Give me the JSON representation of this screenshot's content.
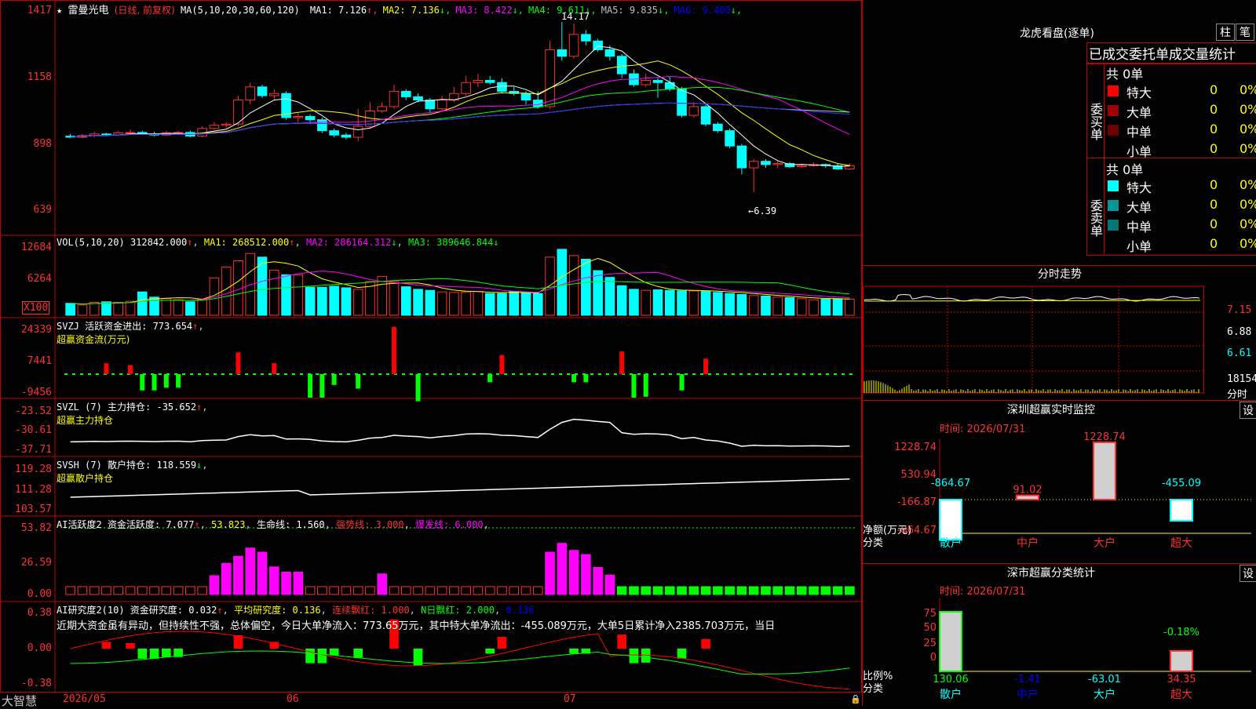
{
  "header": {
    "star": "★",
    "stock_name": "雷曼光电",
    "period": "(日线, 前复权)",
    "ma_label": "MA(5,10,20,30,60,120)",
    "ma": [
      {
        "label": "MA1: 7.126",
        "arrow": "↑",
        "color": "#ffffff"
      },
      {
        "label": "MA2: 7.136",
        "arrow": "↓",
        "color": "#ffff00"
      },
      {
        "label": "MA3: 8.422",
        "arrow": "↓",
        "color": "#ff00ff"
      },
      {
        "label": "MA4: 9.611",
        "arrow": "↓",
        "color": "#00ff00"
      },
      {
        "label": "MA5: 9.835",
        "arrow": "↓",
        "color": "#c0c0c0"
      },
      {
        "label": "MA6: 9.400",
        "arrow": "↓",
        "color": "#0000ff"
      }
    ]
  },
  "price_panel": {
    "y_labels": [
      "1417",
      "1158",
      "898",
      "639"
    ],
    "high_label": "14.17",
    "low_label": "←6.39"
  },
  "vol_panel": {
    "title": "VOL(5,10,20)",
    "value": "312842.000",
    "ma1": "MA1: 268512.000",
    "ma2": "MA2: 286164.312",
    "ma3": "MA3: 389646.844",
    "y_labels": [
      "12684",
      "6264"
    ],
    "unit": "X100"
  },
  "svzj_panel": {
    "title": "SVZJ  活跃资金进出: 773.654",
    "subtitle": "超赢资金流(万元)",
    "y_labels": [
      "24339",
      "7441",
      "-9456"
    ]
  },
  "svzl_panel": {
    "title": "SVZL (7) 主力持仓: -35.652",
    "subtitle": "超赢主力持仓",
    "y_labels": [
      "-23.52",
      "-30.61",
      "-37.71"
    ]
  },
  "svsh_panel": {
    "title": "SVSH (7) 散户持仓: 118.559",
    "subtitle": "超赢散户持仓",
    "y_labels": [
      "119.28",
      "111.28",
      "103.57"
    ]
  },
  "ai_panel": {
    "title": "AI活跃度2 资金活跃度: 7.077",
    "v1": "53.823",
    "life": "生命线: 1.560",
    "strong": "强势线: 3.000",
    "burst": "爆发线: 6.000",
    "y_labels": [
      "53.82",
      "26.59",
      "0.00"
    ]
  },
  "research_panel": {
    "title": "AI研究度2(10) 资金研究度: 0.032",
    "avg": "平均研究度: 0.136",
    "cont": "连续飘红: 1.000",
    "nday": "N日飘红: 2.000",
    "last": "0.136",
    "comment": "近期大资金虽有异动，但持续性不强，总体偏空，今日大单净流入：773.65万元，其中特大单净流出：-455.089万元，大单5日累计净入2385.703万元，当日",
    "y_labels": [
      "0.38",
      "0.00",
      "-0.38"
    ]
  },
  "footer": {
    "brand": "大智慧",
    "dates": [
      "2026/05",
      "06",
      "07"
    ]
  },
  "right": {
    "title": "龙虎看盘(逐单)",
    "btn1": "柱",
    "btn2": "笔",
    "table_title": "已成交委托单成交量统计",
    "buy_label": "委买单",
    "sell_label": "委卖单",
    "buy_total": "共 0单",
    "sell_total": "共 0单",
    "buy_rows": [
      {
        "name": "特大",
        "count": "0",
        "pct": "0%",
        "color": "#ff0000"
      },
      {
        "name": "大单",
        "count": "0",
        "pct": "0%",
        "color": "#a00000"
      },
      {
        "name": "中单",
        "count": "0",
        "pct": "0%",
        "color": "#700000"
      },
      {
        "name": "小单",
        "count": "0",
        "pct": "0%",
        "color": ""
      }
    ],
    "sell_rows": [
      {
        "name": "特大",
        "count": "0",
        "pct": "0%",
        "color": "#00ffff"
      },
      {
        "name": "大单",
        "count": "0",
        "pct": "0%",
        "color": "#009999"
      },
      {
        "name": "中单",
        "count": "0",
        "pct": "0%",
        "color": "#007777"
      },
      {
        "name": "小单",
        "count": "0",
        "pct": "0%",
        "color": ""
      }
    ],
    "intraday_title": "分时走势",
    "intraday_labels": [
      "7.15",
      "6.88",
      "6.61"
    ],
    "intraday_vol": "18154",
    "intraday_unit": "分时",
    "monitor_title": "深圳超赢实时监控",
    "monitor_btn": "设",
    "time_label": "时间: 2026/07/31",
    "monitor_y": [
      "1228.74",
      "530.94",
      "-166.87",
      "-864.67"
    ],
    "monitor_ylabel": "净额(万元)",
    "monitor_xlabel": "分类",
    "categories": [
      "散户",
      "中户",
      "大户",
      "超大"
    ],
    "monitor_bars": [
      {
        "label": "-864.67",
        "value": -864.67
      },
      {
        "label": "91.02",
        "value": 91.02
      },
      {
        "label": "1228.74",
        "value": 1228.74
      },
      {
        "label": "-455.09",
        "value": -455.09
      }
    ],
    "stat_title": "深市超赢分类统计",
    "stat_btn": "设",
    "stat_time": "时间: 2026/07/31",
    "stat_y": [
      "75",
      "50",
      "25",
      "0"
    ],
    "stat_ylabel": "比例%",
    "stat_xlabel": "分类",
    "stat_bar_label": "-0.18%",
    "stat_values": [
      {
        "label": "130.06",
        "value": 100
      },
      {
        "label": "-1.41",
        "value": 0
      },
      {
        "label": "-63.01",
        "value": 0
      },
      {
        "label": "34.35",
        "value": 34.35
      }
    ]
  },
  "chart_data": {
    "type": "candlestick",
    "title": "雷曼光电 (日线, 前复权)",
    "ylim": [
      6.39,
      14.17
    ],
    "candles": [
      [
        8.95,
        8.9,
        9.05,
        8.85
      ],
      [
        8.9,
        8.98,
        9.05,
        8.85
      ],
      [
        8.98,
        9.05,
        9.15,
        8.9
      ],
      [
        9.05,
        9.0,
        9.1,
        8.95
      ],
      [
        9.0,
        9.1,
        9.2,
        8.95
      ],
      [
        9.1,
        9.12,
        9.25,
        9.0
      ],
      [
        9.12,
        9.05,
        9.2,
        9.0
      ],
      [
        9.05,
        9.0,
        9.15,
        8.95
      ],
      [
        9.0,
        9.1,
        9.2,
        8.95
      ],
      [
        9.1,
        9.12,
        9.2,
        9.0
      ],
      [
        9.12,
        8.95,
        9.2,
        8.9
      ],
      [
        8.95,
        9.3,
        9.4,
        8.9
      ],
      [
        9.3,
        9.45,
        9.6,
        9.25
      ],
      [
        9.45,
        9.5,
        9.6,
        9.3
      ],
      [
        9.5,
        10.6,
        10.8,
        9.4
      ],
      [
        10.6,
        11.2,
        11.4,
        10.4
      ],
      [
        11.2,
        10.8,
        11.3,
        10.7
      ],
      [
        10.8,
        10.9,
        11.1,
        10.6
      ],
      [
        10.9,
        9.8,
        11.0,
        9.7
      ],
      [
        9.8,
        9.85,
        10.0,
        9.6
      ],
      [
        9.85,
        9.7,
        9.95,
        9.5
      ],
      [
        9.7,
        9.2,
        9.8,
        9.1
      ],
      [
        9.2,
        9.0,
        9.3,
        8.9
      ],
      [
        9.0,
        8.9,
        9.1,
        8.8
      ],
      [
        8.9,
        9.4,
        10.2,
        8.7
      ],
      [
        9.4,
        10.1,
        10.5,
        9.3
      ],
      [
        10.1,
        10.3,
        10.5,
        10.0
      ],
      [
        10.3,
        11.0,
        11.3,
        10.2
      ],
      [
        11.0,
        10.75,
        11.1,
        10.6
      ],
      [
        10.75,
        10.6,
        10.9,
        10.5
      ],
      [
        10.6,
        10.2,
        10.7,
        10.0
      ],
      [
        10.2,
        10.6,
        10.8,
        10.1
      ],
      [
        10.6,
        10.9,
        11.2,
        10.5
      ],
      [
        10.9,
        11.4,
        11.7,
        10.8
      ],
      [
        11.4,
        11.5,
        11.8,
        11.2
      ],
      [
        11.5,
        11.4,
        11.7,
        11.3
      ],
      [
        11.4,
        11.0,
        11.6,
        10.9
      ],
      [
        11.0,
        10.9,
        11.2,
        10.8
      ],
      [
        10.9,
        10.6,
        11.0,
        10.4
      ],
      [
        10.6,
        10.3,
        11.0,
        10.2
      ],
      [
        10.3,
        12.9,
        13.3,
        10.2
      ],
      [
        12.9,
        12.6,
        14.17,
        12.4
      ],
      [
        12.6,
        13.6,
        14.1,
        12.5
      ],
      [
        13.6,
        13.3,
        13.8,
        13.1
      ],
      [
        13.3,
        12.9,
        13.4,
        12.8
      ],
      [
        12.9,
        12.6,
        13.1,
        12.4
      ],
      [
        12.6,
        11.8,
        12.7,
        11.6
      ],
      [
        11.8,
        11.3,
        12.0,
        11.2
      ],
      [
        11.3,
        11.5,
        11.8,
        11.2
      ],
      [
        11.5,
        11.4,
        11.6,
        10.7
      ],
      [
        11.4,
        11.1,
        11.7,
        11.0
      ],
      [
        11.1,
        9.9,
        11.2,
        9.8
      ],
      [
        9.9,
        10.3,
        10.5,
        9.8
      ],
      [
        10.3,
        9.5,
        10.4,
        9.4
      ],
      [
        9.5,
        9.2,
        9.6,
        9.1
      ],
      [
        9.2,
        8.5,
        9.3,
        8.4
      ],
      [
        8.5,
        7.5,
        8.6,
        7.2
      ],
      [
        7.5,
        7.8,
        7.9,
        6.39
      ],
      [
        7.8,
        7.65,
        7.9,
        7.5
      ],
      [
        7.65,
        7.7,
        7.8,
        7.5
      ],
      [
        7.7,
        7.55,
        7.75,
        7.5
      ],
      [
        7.55,
        7.6,
        7.7,
        7.5
      ],
      [
        7.6,
        7.65,
        7.75,
        7.55
      ],
      [
        7.65,
        7.6,
        7.7,
        7.5
      ],
      [
        7.6,
        7.45,
        7.7,
        7.4
      ],
      [
        7.45,
        7.6,
        7.7,
        7.4
      ]
    ],
    "volume": [
      2.3,
      2.0,
      2.5,
      2.6,
      2.5,
      2.7,
      4.5,
      3.5,
      3.2,
      3.0,
      2.6,
      3.1,
      7.2,
      9.3,
      10.5,
      11.9,
      11.2,
      8.7,
      7.8,
      7.8,
      5.4,
      5.4,
      5.6,
      5.3,
      5.0,
      6.5,
      7.5,
      6.5,
      5.5,
      5.0,
      4.8,
      4.5,
      4.4,
      4.5,
      4.6,
      4.2,
      4.2,
      4.6,
      4.4,
      4.2,
      11.2,
      12.7,
      11.5,
      10.8,
      8.6,
      7.3,
      5.7,
      5.0,
      4.8,
      4.9,
      4.8,
      4.7,
      4.7,
      4.6,
      4.4,
      4.2,
      4.0,
      3.8,
      3.7,
      3.5,
      3.4,
      3.2,
      3.0,
      3.1,
      3.2,
      3.1
    ],
    "fund_flow": [
      0,
      0,
      0,
      1200,
      0,
      1000,
      -1800,
      -1800,
      -1500,
      -1500,
      0,
      0,
      0,
      0,
      2400,
      0,
      0,
      1200,
      0,
      0,
      -2600,
      -2600,
      -1200,
      0,
      -1600,
      0,
      0,
      5200,
      0,
      -3000,
      0,
      0,
      0,
      0,
      0,
      -900,
      2100,
      0,
      0,
      0,
      0,
      0,
      -900,
      -900,
      0,
      0,
      2500,
      -2600,
      -2500,
      0,
      0,
      -1800,
      0,
      1700,
      0,
      0,
      0,
      0,
      0,
      0,
      0,
      0,
      0,
      0,
      0,
      0
    ]
  }
}
